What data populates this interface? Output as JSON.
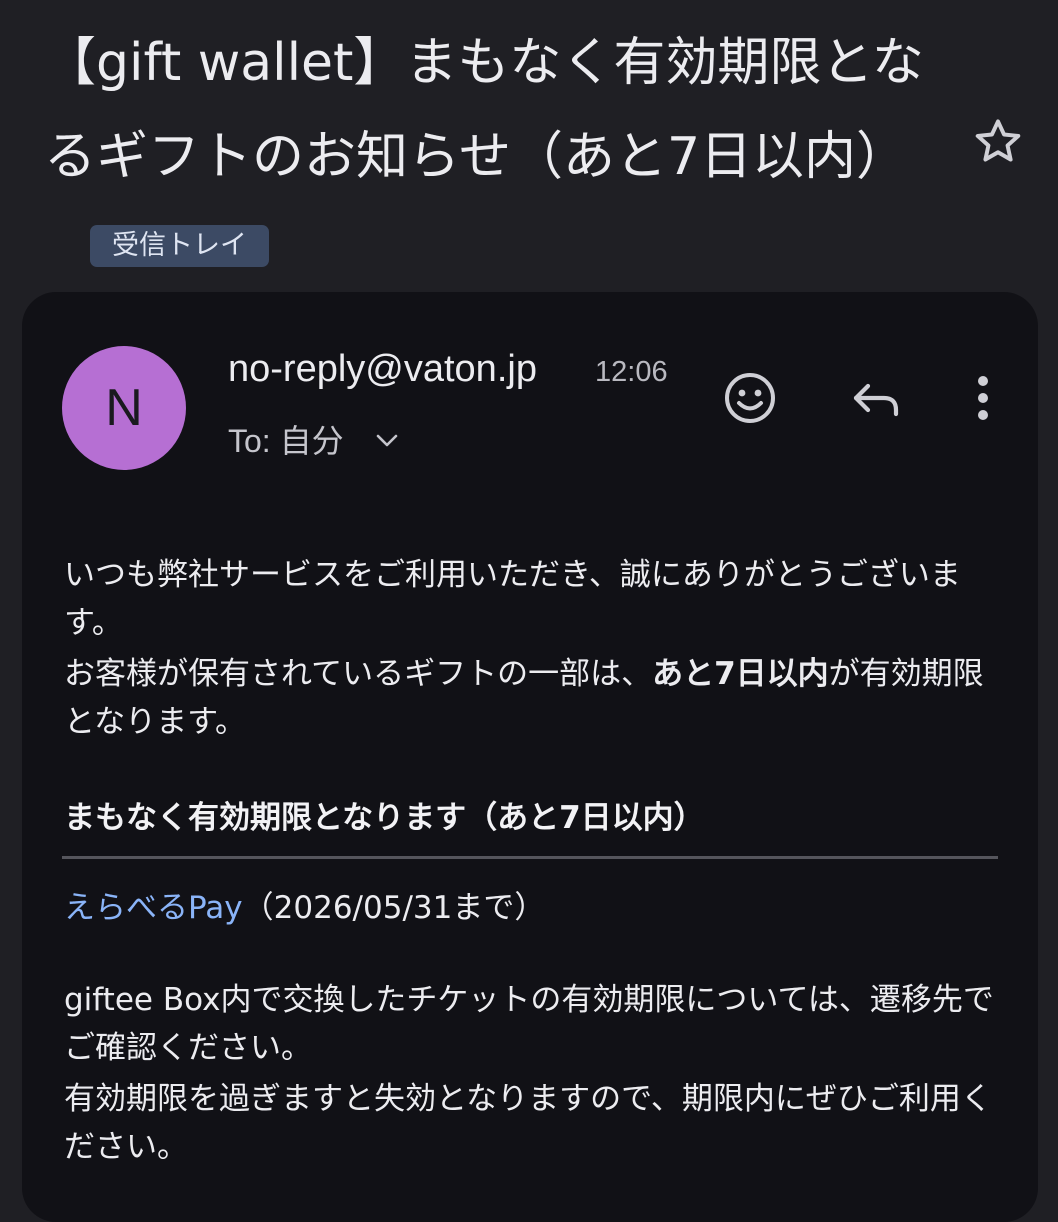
{
  "email": {
    "subject": "【gift wallet】まもなく有効期限となるギフトのお知らせ（あと7日以内）",
    "label": "受信トレイ",
    "sender": "no-reply@vaton.jp",
    "time": "12:06",
    "avatar_letter": "N",
    "to_prefix": "To:",
    "to_value": "自分"
  },
  "body": {
    "greeting": "いつも弊社サービスをご利用いただき、誠にありがとうございます。",
    "notice_before": "お客様が保有されているギフトの一部は、",
    "notice_bold": "あと7日以内",
    "notice_after": "が有効期限となります。",
    "section_title": "まもなく有効期限となります（あと7日以内）",
    "gift_name": "えらべるPay",
    "gift_expiry": "（2026/05/31まで）",
    "footer_line1": "giftee Box内で交換したチケットの有効期限については、遷移先でご確認ください。",
    "footer_line2": "有効期限を過ぎますと失効となりますので、期限内にぜひご利用ください。"
  },
  "icons": {
    "star": "star-outline-icon",
    "emoji": "emoji-icon",
    "reply": "reply-icon",
    "more": "more-vert-icon",
    "chevron": "chevron-down-icon"
  },
  "colors": {
    "avatar": "#b66fd3",
    "link": "#8ab4f8",
    "label_chip": "#3c4a64"
  }
}
